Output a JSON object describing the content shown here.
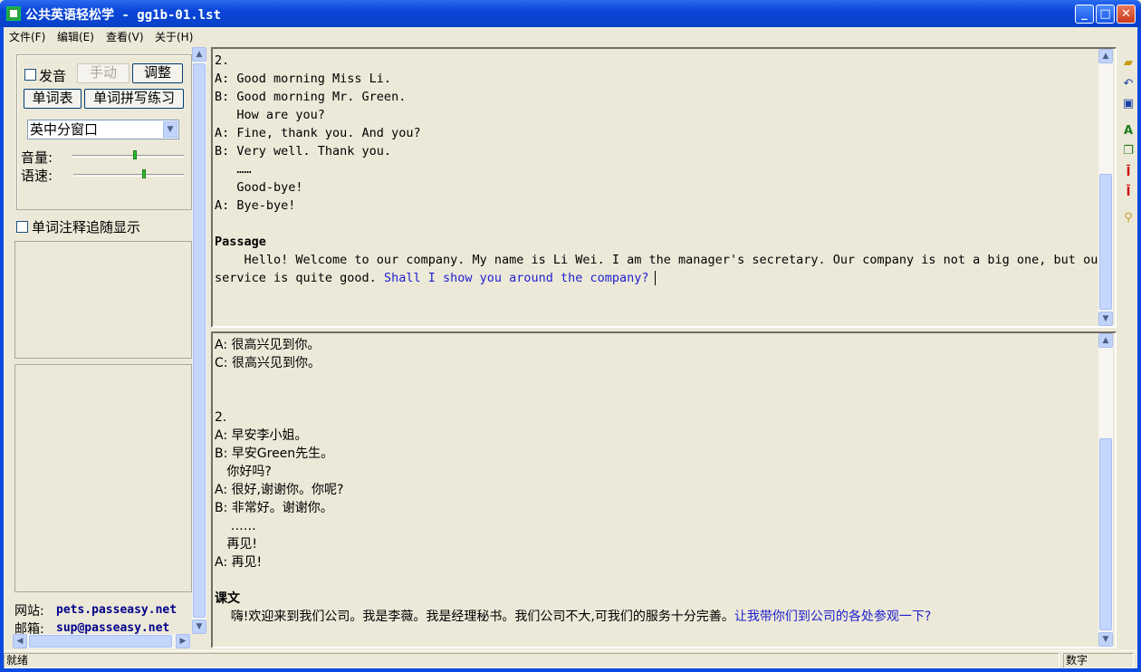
{
  "window": {
    "title": "公共英语轻松学 - gg1b-01.lst",
    "minimize": "_",
    "maximize": "□",
    "close": "✕"
  },
  "menu": {
    "file": "文件(F)",
    "edit": "编辑(E)",
    "view": "查看(V)",
    "about": "关于(H)"
  },
  "controls": {
    "pronounce_label": "发音",
    "manual_button": "手动",
    "adjust_button": "调整",
    "wordlist_button": "单词表",
    "spelling_button": "单词拼写练习",
    "window_mode_selected": "英中分窗口",
    "volume_label": "音量:",
    "speed_label": "语速:",
    "volume_level": 0.55,
    "speed_level": 0.62,
    "word_note_follow_label": "单词注释追随显示"
  },
  "footer_links": {
    "website_label": "网站:",
    "website_value": "pets.passeasy.net",
    "email_label": "邮箱:",
    "email_value": "sup@passeasy.net"
  },
  "english_pane": {
    "lines": [
      {
        "text": "2.",
        "style": ""
      },
      {
        "text": "A: Good morning Miss Li.",
        "style": ""
      },
      {
        "text": "B: Good morning Mr. Green.",
        "style": ""
      },
      {
        "text": "   How are you?",
        "style": ""
      },
      {
        "text": "A: Fine, thank you. And you?",
        "style": ""
      },
      {
        "text": "B: Very well. Thank you.",
        "style": ""
      },
      {
        "text": "   ……",
        "style": ""
      },
      {
        "text": "   Good-bye!",
        "style": ""
      },
      {
        "text": "A: Bye-bye!",
        "style": ""
      },
      {
        "text": "",
        "style": ""
      },
      {
        "text": "Passage",
        "style": "bold"
      }
    ],
    "passage_line1": "    Hello! Welcome to our company. My name is Li Wei. I am the manager's secretary. Our company is not a big one, but our",
    "passage_line2_plain": "service is quite good. ",
    "passage_line2_highlight": "Shall I show you around the company?"
  },
  "chinese_pane": {
    "lines": [
      {
        "text": "A: 很高兴见到你。",
        "style": ""
      },
      {
        "text": "C: 很高兴见到你。",
        "style": ""
      },
      {
        "text": "",
        "style": ""
      },
      {
        "text": "",
        "style": ""
      },
      {
        "text": "2.",
        "style": ""
      },
      {
        "text": "A: 早安李小姐。",
        "style": ""
      },
      {
        "text": "B: 早安Green先生。",
        "style": ""
      },
      {
        "text": "   你好吗?",
        "style": ""
      },
      {
        "text": "A: 很好,谢谢你。你呢?",
        "style": ""
      },
      {
        "text": "B: 非常好。谢谢你。",
        "style": ""
      },
      {
        "text": "    ……",
        "style": ""
      },
      {
        "text": "   再见!",
        "style": ""
      },
      {
        "text": "A: 再见!",
        "style": ""
      },
      {
        "text": "",
        "style": ""
      },
      {
        "text": "课文",
        "style": "bold"
      }
    ],
    "passage_plain": "    嗨!欢迎来到我们公司。我是李薇。我是经理秘书。我们公司不大,可我们的服务十分完善。",
    "passage_highlight": "让我带你们到公司的各处参观一下?"
  },
  "toolbar_icons": [
    "folder-open-icon",
    "undo-icon",
    "save-icon",
    "font-icon",
    "copy-icon",
    "text-up-icon",
    "text-down-icon",
    "search-icon"
  ],
  "status": {
    "left": "就绪",
    "right": "数字"
  },
  "colors": {
    "highlight": "#1E1ED0",
    "titlebar": "#0A45D8",
    "background": "#ECE9D8"
  }
}
